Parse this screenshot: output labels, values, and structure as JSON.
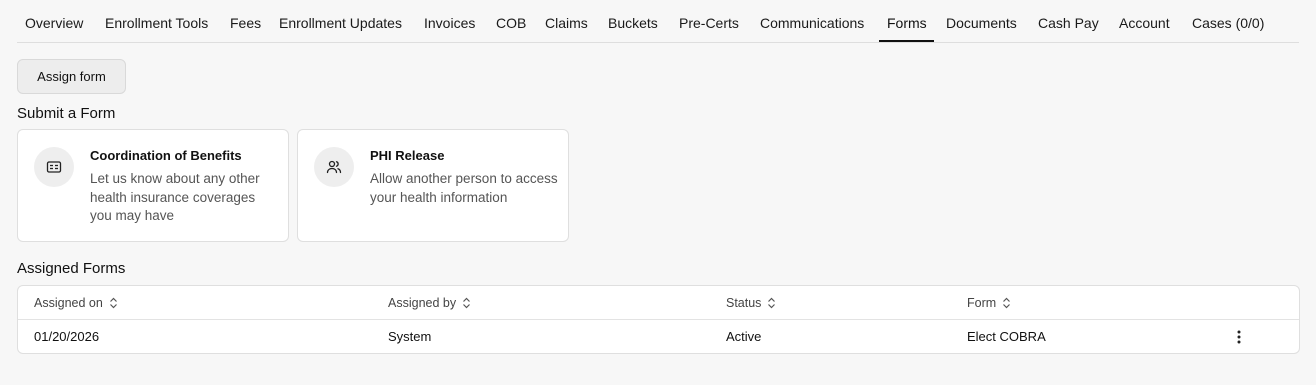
{
  "tabs": [
    {
      "label": "Overview"
    },
    {
      "label": "Enrollment Tools"
    },
    {
      "label": "Fees"
    },
    {
      "label": "Enrollment Updates"
    },
    {
      "label": "Invoices"
    },
    {
      "label": "COB"
    },
    {
      "label": "Claims"
    },
    {
      "label": "Buckets"
    },
    {
      "label": "Pre-Certs"
    },
    {
      "label": "Communications"
    },
    {
      "label": "Forms"
    },
    {
      "label": "Documents"
    },
    {
      "label": "Cash Pay"
    },
    {
      "label": "Account"
    },
    {
      "label": "Cases (0/0)"
    }
  ],
  "active_tab": "Forms",
  "assign_button": "Assign form",
  "submit_section": {
    "title": "Submit a Form",
    "cards": [
      {
        "title": "Coordination of Benefits",
        "description": "Let us know about any other health insurance coverages you may have",
        "icon": "id-card-icon"
      },
      {
        "title": "PHI Release",
        "description": "Allow another person to access your health information",
        "icon": "users-icon"
      }
    ]
  },
  "assigned_section": {
    "title": "Assigned Forms",
    "columns": [
      "Assigned on",
      "Assigned by",
      "Status",
      "Form"
    ],
    "rows": [
      {
        "assigned_on": "01/20/2026",
        "assigned_by": "System",
        "status": "Active",
        "form": "Elect COBRA"
      }
    ]
  },
  "icons": {
    "sort": "sort-icon",
    "row_menu": "more-vertical-icon"
  }
}
